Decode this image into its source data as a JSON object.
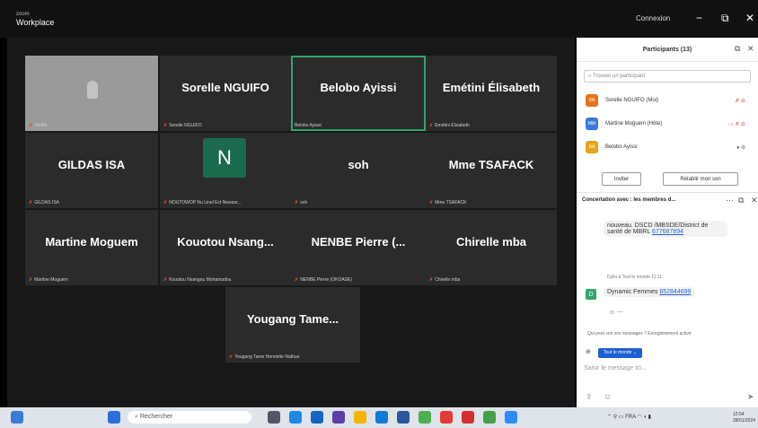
{
  "app": {
    "brand_top": "zoom",
    "brand": "Workplace",
    "connect_label": "Connexion",
    "minimize": "−",
    "maximize": "⧉",
    "close": "✕"
  },
  "tiles": [
    {
      "name": "",
      "tag": "Vérifié"
    },
    {
      "name": "Sorelle NGUIFO",
      "tag": "Sorelle NGUIFO"
    },
    {
      "name": "Belobo Ayissi",
      "tag": "Belobo Ayissi"
    },
    {
      "name": "Emétini Élisabeth",
      "tag": "Emétini Élisabeth"
    },
    {
      "name": "GILDAS ISA",
      "tag": "GILDAS ISA"
    },
    {
      "name": "N",
      "tag": "NOUTOWOP Nu Linel Ect Newsor..."
    },
    {
      "name": "soh",
      "tag": "soh"
    },
    {
      "name": "Mme TSAFACK",
      "tag": "Mme TSAFACK"
    },
    {
      "name": "Martine Moguem",
      "tag": "Martine Moguem"
    },
    {
      "name": "Kouotou  Nsang...",
      "tag": "Kouotou Nsangou Mohamadou"
    },
    {
      "name": "NENBE  Pierre  (...",
      "tag": "NENBE Pierre (OKOASE)"
    },
    {
      "name": "Chirelle mba",
      "tag": "Chirelle mba"
    },
    {
      "name": "Yougang  Tame...",
      "tag": "Yougang Tame Henriette Nathue"
    }
  ],
  "participants": {
    "title": "Participants (13)",
    "search_placeholder": "Trouver un participant",
    "items": [
      {
        "initials": "SN",
        "name": "Sorelle NGUIFO (Moi)",
        "color": "#e8711c"
      },
      {
        "initials": "MM",
        "name": "Martine Moguem (Hôte)",
        "color": "#3b78d6"
      },
      {
        "initials": "BA",
        "name": "Belobo Ayissi",
        "color": "#e8a21c"
      }
    ],
    "invite_label": "Inviter",
    "unmute_label": "Rétablir mon son"
  },
  "chat": {
    "header": "Concertation avec : les membres d...",
    "msg1": "nouveau. DSCD /MBSDE/District de santé de MBRL",
    "msg1_link": "677687894",
    "meta": "Dylla à Tout le monde 11:11",
    "badge": "D",
    "msg2": "Dynamic Femmes",
    "msg2_link": "652844699",
    "notice": "Qui peut voir vos messages ? Enregistrement activé",
    "to_label": "Tout le monde ⌄",
    "input_placeholder": "Saisir le message ici..."
  },
  "taskbar": {
    "search_label": "Rechercher",
    "lang": "FRA",
    "time": "12:54",
    "date": "28/01/2024"
  }
}
